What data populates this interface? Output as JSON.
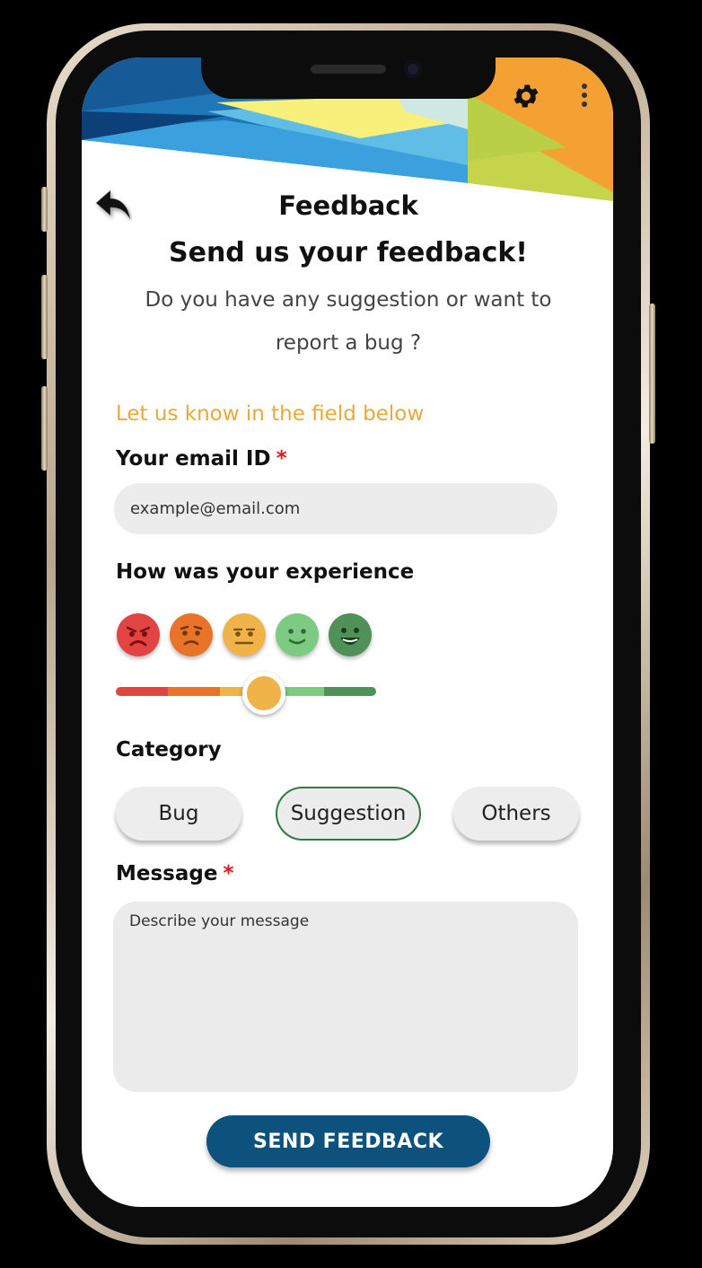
{
  "screen": {
    "title": "Feedback",
    "subtitle": "Send us your feedback!",
    "description": "Do you have any suggestion or want to report a bug ?",
    "hint": "Let us know in the field below"
  },
  "header_icons": {
    "settings": "gear-icon",
    "menu": "kebab-menu-icon",
    "back": "back-arrow-icon"
  },
  "email": {
    "label": "Your email ID",
    "required_mark": "*",
    "placeholder": "example@email.com",
    "value": ""
  },
  "experience": {
    "label": "How was your experience",
    "faces": [
      {
        "name": "very-angry-face-icon",
        "color": "#e24444"
      },
      {
        "name": "sad-face-icon",
        "color": "#e77428"
      },
      {
        "name": "neutral-face-icon",
        "color": "#efb34a"
      },
      {
        "name": "smile-face-icon",
        "color": "#7dca82"
      },
      {
        "name": "happy-face-icon",
        "color": "#4f9159"
      }
    ],
    "rating_fraction": 0.57
  },
  "category": {
    "label": "Category",
    "options": [
      "Bug",
      "Suggestion",
      "Others"
    ],
    "selected": "Suggestion"
  },
  "message": {
    "label": "Message",
    "required_mark": "*",
    "placeholder": "Describe your message",
    "value": ""
  },
  "send_button": {
    "label": "SEND FEEDBACK"
  },
  "colors": {
    "accent_orange": "#e8a93a",
    "primary_blue": "#0d527c",
    "selected_green": "#2f7a43",
    "required_red": "#e01b1b"
  }
}
